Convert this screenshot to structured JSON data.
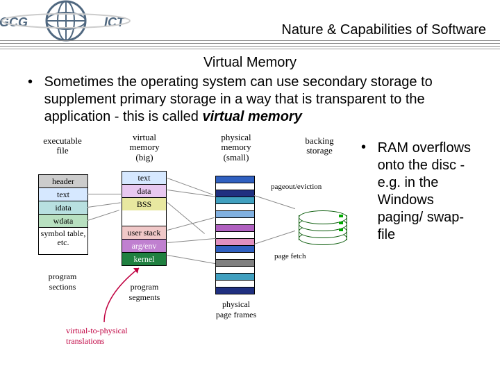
{
  "header": {
    "title": "Nature & Capabilities of Software",
    "logo_left": "GCG",
    "logo_right": "ICT"
  },
  "section_title": "Virtual Memory",
  "bullet_main": {
    "prefix": "Sometimes the operating system can use secondary storage to supplement primary storage in a way that is transparent to the application - this is called ",
    "emph": "virtual memory"
  },
  "bullet_side": "RAM overflows onto the disc - e.g. in the Windows paging/ swap-file",
  "diagram": {
    "labels": {
      "executable_file": "executable\nfile",
      "virtual_memory": "virtual\nmemory\n(big)",
      "physical_memory": "physical\nmemory\n(small)",
      "backing_storage": "backing\nstorage",
      "program_sections": "program\nsections",
      "program_segments": "program\nsegments",
      "physical_page_frames": "physical\npage frames",
      "pageout_eviction": "pageout/eviction",
      "page_fetch": "page fetch",
      "v2p": "virtual-to-physical\ntranslations"
    },
    "exe_rows": [
      "header",
      "text",
      "idata",
      "wdata",
      "symbol table, etc."
    ],
    "vmem_rows": [
      "text",
      "data",
      "BSS",
      "",
      "user stack",
      "arg/env",
      "kernel"
    ]
  }
}
